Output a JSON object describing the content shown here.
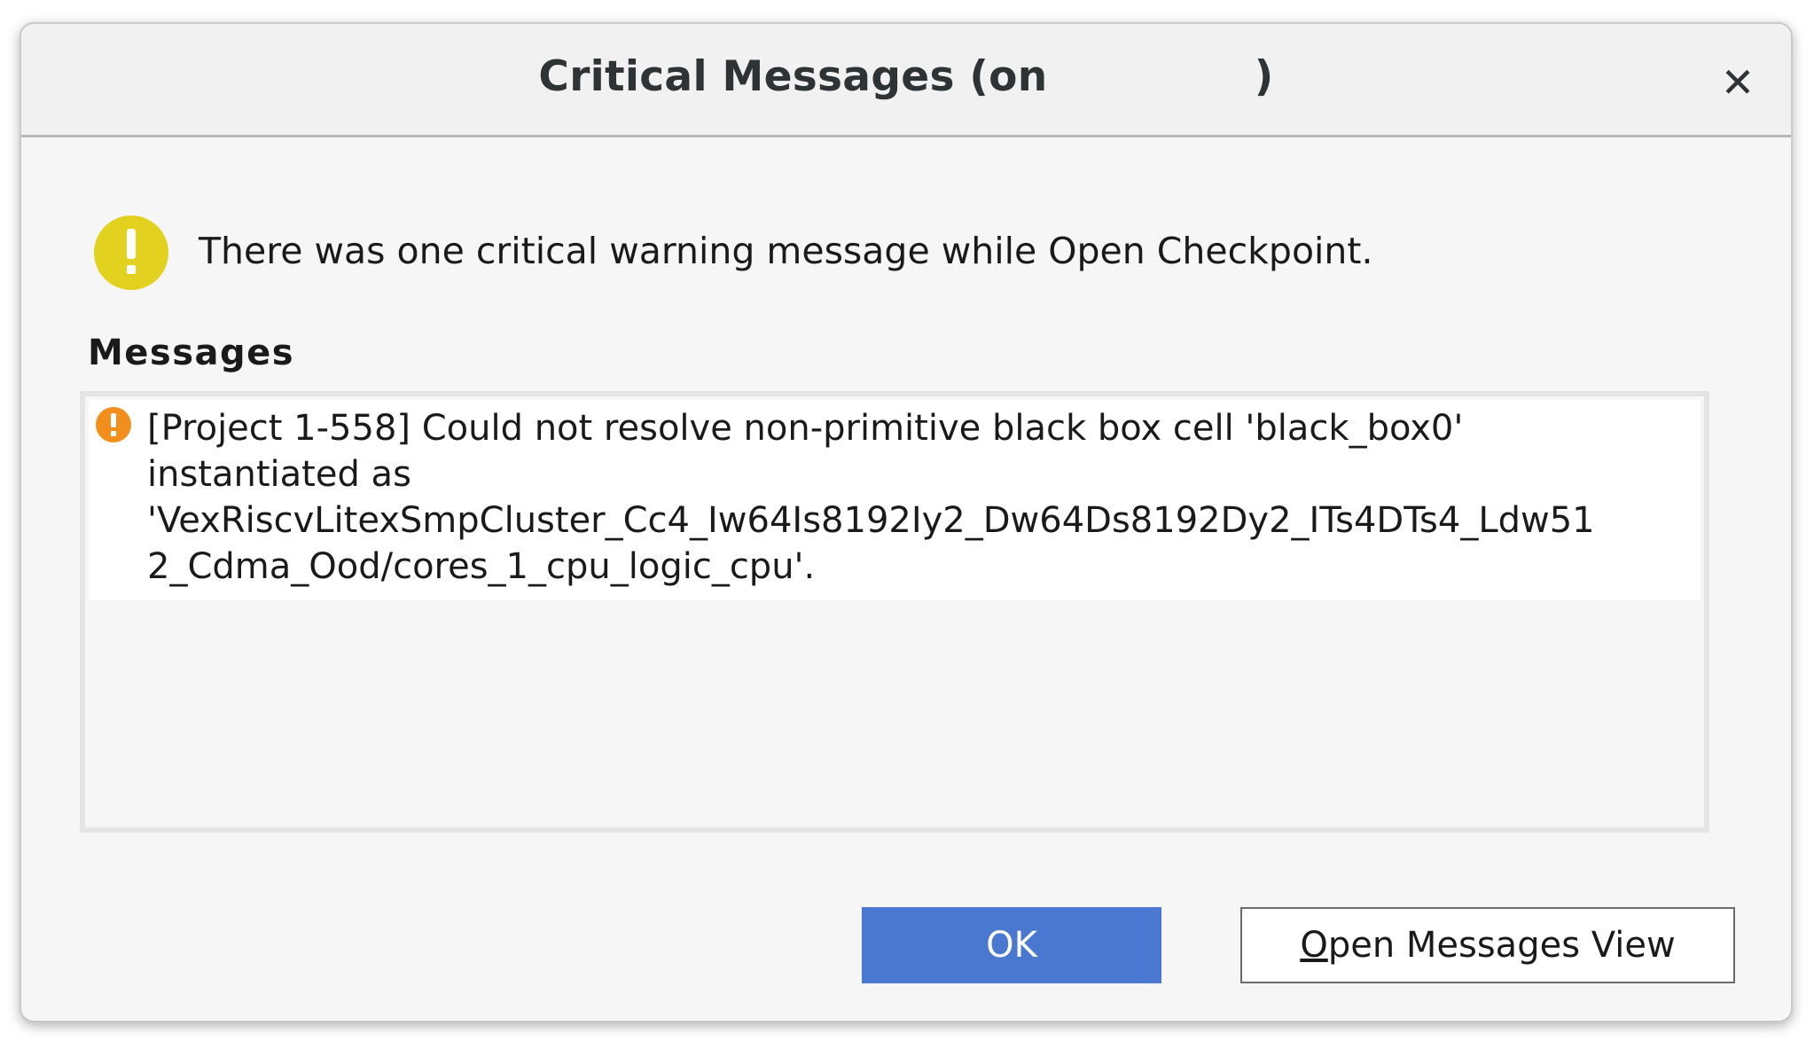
{
  "dialog": {
    "title": "Critical Messages (on              )",
    "close_glyph": "✕",
    "summary": "There was one critical warning message while Open Checkpoint.",
    "summary_icon": "warning-circle-icon",
    "summary_icon_color": "#e2d21f"
  },
  "messages": {
    "heading": "Messages",
    "items": [
      {
        "icon": "critical-warning-icon",
        "icon_color": "#f28e1c",
        "lines": [
          "[Project 1-558] Could not resolve non-primitive black box cell 'black_box0'",
          "instantiated as",
          "'VexRiscvLitexSmpCluster_Cc4_Iw64Is8192Iy2_Dw64Ds8192Dy2_ITs4DTs4_Ldw51",
          "2_Cdma_Ood/cores_1_cpu_logic_cpu'."
        ]
      }
    ]
  },
  "buttons": {
    "ok_label": "OK",
    "open_view_mnemonic": "O",
    "open_view_rest": "pen Messages View",
    "ok_color": "#4a78d1"
  }
}
